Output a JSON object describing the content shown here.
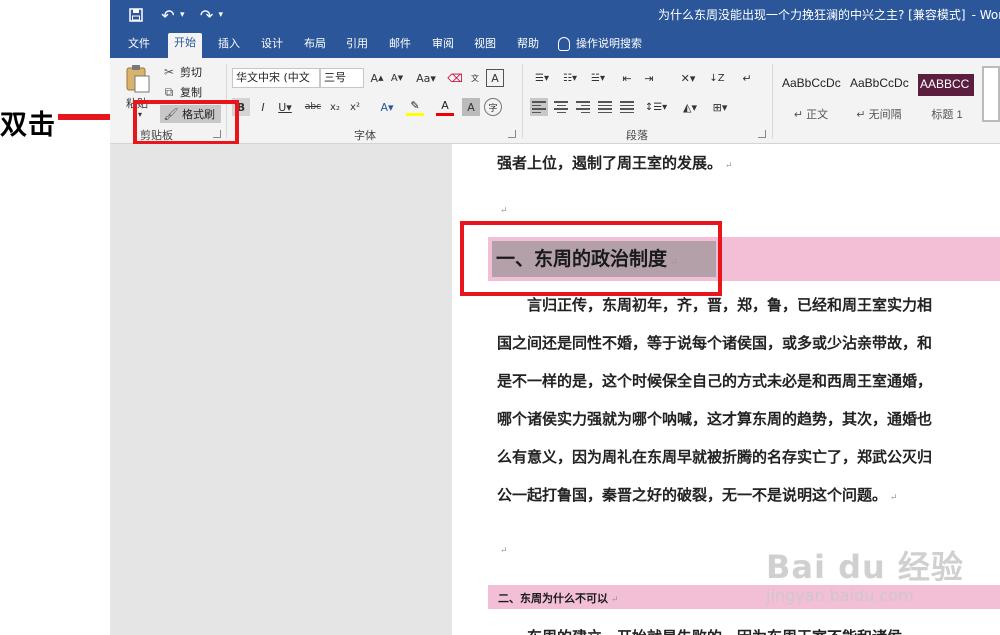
{
  "annotation": {
    "label": "双击"
  },
  "titlebar": {
    "doc_title": "为什么东周没能出现一个力挽狂澜的中兴之主? [兼容模式]",
    "app_name": "- Word"
  },
  "tabs": [
    "文件",
    "开始",
    "插入",
    "设计",
    "布局",
    "引用",
    "邮件",
    "审阅",
    "视图",
    "帮助"
  ],
  "tell_me": "操作说明搜索",
  "clipboard": {
    "paste": "粘贴",
    "cut": "剪切",
    "copy": "复制",
    "format_painter": "格式刷",
    "group_label": "剪贴板"
  },
  "font": {
    "name": "华文中宋 (中文",
    "size": "三号",
    "group_label": "字体"
  },
  "paragraph": {
    "group_label": "段落"
  },
  "styles": [
    {
      "sample": "AaBbCcDc",
      "name": "↵ 正文"
    },
    {
      "sample": "AaBbCcDc",
      "name": "↵ 无间隔"
    },
    {
      "sample": "AABBCC",
      "name": "标题 1"
    }
  ],
  "document": {
    "line_top": "强者上位，遏制了周王室的发展。",
    "heading1": "一、东周的政治制度",
    "body": [
      "　　言归正传，东周初年，齐，晋，郑，鲁，已经和周王室实力相",
      "国之间还是同性不婚，等于说每个诸侯国，或多或少沾亲带故，和",
      "是不一样的是，这个时候保全自己的方式未必是和西周王室通婚，",
      "哪个诸侯实力强就为哪个呐喊，这才算东周的趋势，其次，通婚也",
      "么有意义，因为周礼在东周早就被折腾的名存实亡了，郑武公灭归",
      "公一起打鲁国，秦晋之好的破裂，无一不是说明这个问题。"
    ],
    "body_last_prefix": "公",
    "heading2": "二、东周为什么不可以",
    "bottom_partial": "　　东周的建立，开始就是失败的，因为东周王室不能和诸侯，"
  },
  "watermark": {
    "top": "Bai du 经验",
    "bottom": "jingyan.baidu.com"
  },
  "colors": {
    "ribbon_blue": "#2b579a",
    "annotation_red": "#e8151d",
    "heading_band": "#f2bfd7",
    "heading1_style": "#5b1e3f"
  }
}
